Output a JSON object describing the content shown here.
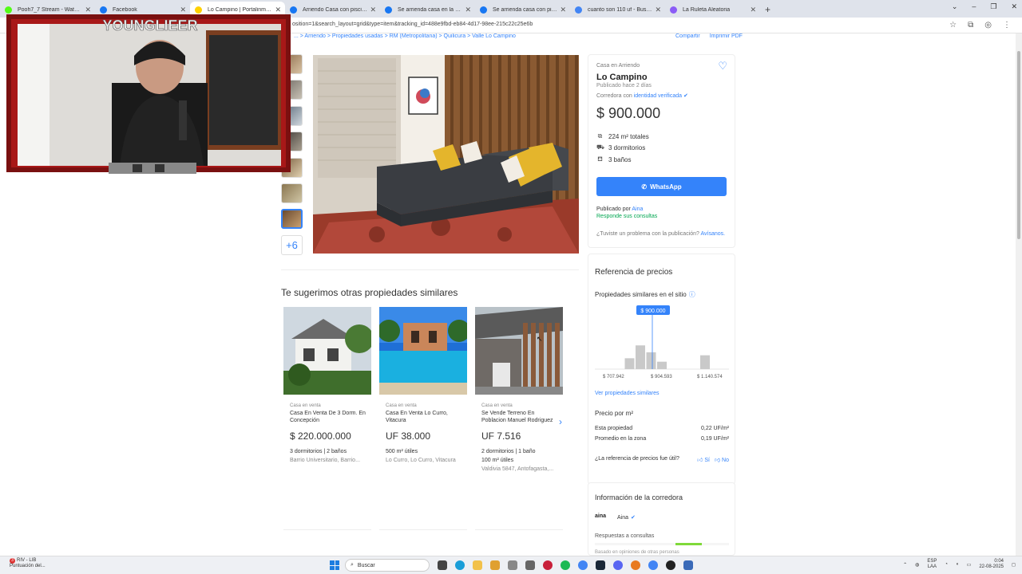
{
  "browser": {
    "tabs": [
      {
        "title": "Pooh7_7 Stream - Watch Live o",
        "color": "#53fc18",
        "active": false
      },
      {
        "title": "Facebook",
        "color": "#1877f2",
        "active": false
      },
      {
        "title": "Lo Campino | Portalinmobiliario",
        "color": "#ffd100",
        "active": true
      },
      {
        "title": "Arriendo Casa con piscina pod",
        "color": "#1877f2",
        "active": false
      },
      {
        "title": "Se arrienda casa en la comuna",
        "color": "#1877f2",
        "active": false
      },
      {
        "title": "Se arrienda casa con piscina -",
        "color": "#1877f2",
        "active": false
      },
      {
        "title": "cuanto son 110 uf - Buscar con",
        "color": "#4285f4",
        "active": false
      },
      {
        "title": "La Ruleta Aleatoria",
        "color": "#8b5cf6",
        "active": false
      }
    ],
    "url": "osition=1&search_layout=grid&type=item&tracking_id=488e9fbd-eb84-4d17-98ee-215c22c25e6b"
  },
  "breadcrumb": "... > Arriendo > Propiedades usadas > RM (Metropolitana) > Quilicura > Valle Lo Campino",
  "page_actions": {
    "share": "Compartir",
    "print": "Imprimir PDF"
  },
  "gallery": {
    "more_label": "+6"
  },
  "listing": {
    "kind": "Casa en Arriendo",
    "title": "Lo Campino",
    "published": "Publicado hace 2 días",
    "broker_prefix": "Corredora con",
    "broker_verified": "identidad verificada",
    "price": "$ 900.000",
    "features": [
      {
        "icon": "area-icon",
        "glyph": "⧉",
        "text": "224 m² totales"
      },
      {
        "icon": "bed-icon",
        "glyph": "⛟",
        "text": "3 dormitorios"
      },
      {
        "icon": "bath-icon",
        "glyph": "⛾",
        "text": "3 baños"
      }
    ],
    "whatsapp_label": "WhatsApp",
    "published_by_prefix": "Publicado por",
    "published_by": "Aina",
    "responds": "Responde sus consultas",
    "problem_text": "¿Tuviste un problema con la publicación?",
    "problem_link": "Avísanos."
  },
  "price_ref": {
    "title": "Referencia de precios",
    "similar_label": "Propiedades similares en el sitio",
    "marker": "$ 900.000",
    "ticks": [
      "$ 707.942",
      "$ 904.593",
      "$ 1.140.574"
    ],
    "bars": [
      0,
      0.22,
      0.48,
      0.34,
      0.15,
      0,
      0,
      0,
      0.28,
      0
    ],
    "see_link": "Ver propiedades similares",
    "per_m2_label": "Precio por m²",
    "rows": [
      {
        "label": "Esta propiedad",
        "value": "0,22 UF/m²"
      },
      {
        "label": "Promedio en la zona",
        "value": "0,19 UF/m²"
      }
    ],
    "useful_q": "¿La referencia de precios fue útil?",
    "yes": "Sí",
    "no": "No"
  },
  "agency": {
    "title": "Información de la corredora",
    "logo_text": "aina",
    "name": "Aina",
    "responses_label": "Respuestas a consultas",
    "note": "Basado en opiniones de otras personas"
  },
  "similar": {
    "title": "Te sugerimos otras propiedades similares",
    "items": [
      {
        "kind": "Casa en venta",
        "title": "Casa En Venta De 3 Dorm. En Concepción",
        "price": "$ 220.000.000",
        "attrs": "3 dormitorios | 2 baños",
        "loc": "Barrio Universitario, Barrio..."
      },
      {
        "kind": "Casa en venta",
        "title": "Casa En Venta Lo Curro, Vitacura",
        "price": "UF 38.000",
        "attrs": "500 m² útiles",
        "loc": "Lo Curro, Lo Curro, Vitacura"
      },
      {
        "kind": "Casa en venta",
        "title": "Se Vende Terreno En Poblacion Manuel Rodriguez",
        "price": "UF 7.516",
        "attrs": "2 dormitorios | 1 baño\n100 m² útiles",
        "loc": "Valdivia 5847, Antofagasta,..."
      }
    ]
  },
  "overlay": {
    "stream_name": "YOUNGLIEER"
  },
  "taskbar": {
    "weather_badge": "3",
    "weather_title": "RIV - LIB",
    "weather_sub": "Puntuación del...",
    "search_placeholder": "Buscar",
    "lang": "ESP",
    "lang_sub": "LAA",
    "time": "0:04",
    "date": "22-08-2025"
  },
  "colors": {
    "accent": "#3483fa",
    "whatsapp": "#3483fa",
    "success": "#00a650"
  }
}
